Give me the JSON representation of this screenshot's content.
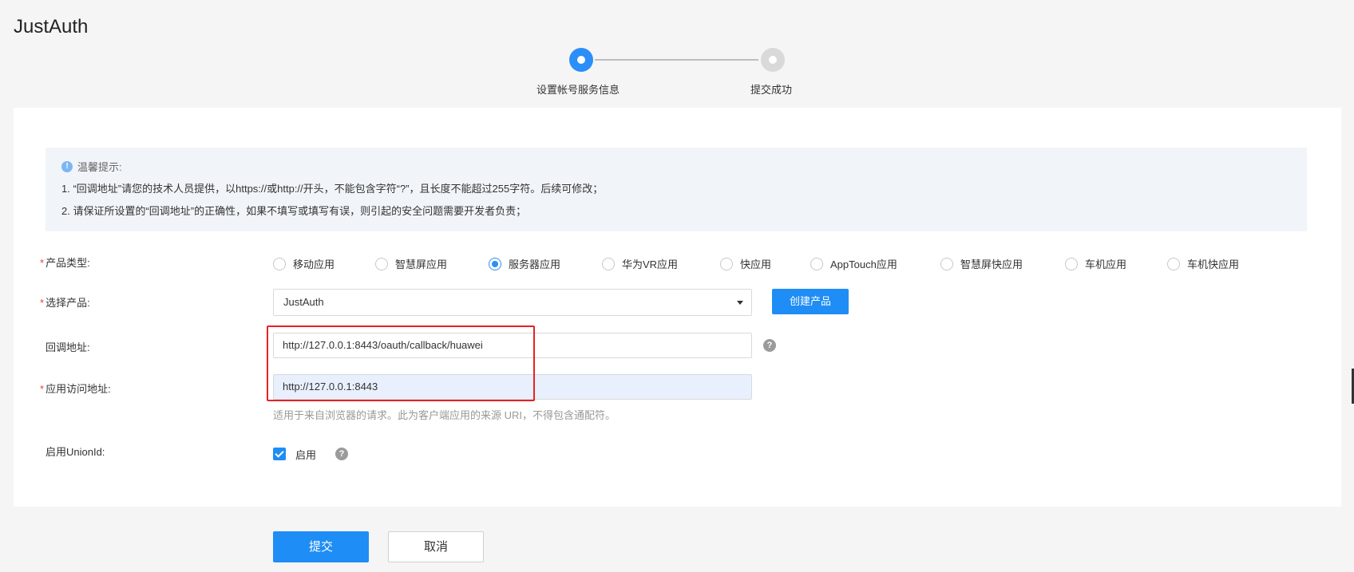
{
  "app": {
    "title": "JustAuth"
  },
  "steps": [
    {
      "label": "设置帐号服务信息",
      "state": "active"
    },
    {
      "label": "提交成功",
      "state": "todo"
    }
  ],
  "notice": {
    "title": "温馨提示:",
    "lines": [
      "1. “回调地址”请您的技术人员提供，以https://或http://开头，不能包含字符“?”，且长度不能超过255字符。后续可修改；",
      "2. 请保证所设置的“回调地址”的正确性，如果不填写或填写有误，则引起的安全问题需要开发者负责；"
    ]
  },
  "form": {
    "required_mark": "*",
    "product_type": {
      "label": "产品类型:",
      "options": [
        "移动应用",
        "智慧屏应用",
        "服务器应用",
        "华为VR应用",
        "快应用",
        "AppTouch应用",
        "智慧屏快应用",
        "车机应用",
        "车机快应用"
      ],
      "selected": "服务器应用"
    },
    "product": {
      "label": "选择产品:",
      "value": "JustAuth",
      "create_label": "创建产品"
    },
    "callback": {
      "label": "回调地址:",
      "value": "http://127.0.0.1:8443/oauth/callback/huawei",
      "help": "?"
    },
    "app_url": {
      "label": "应用访问地址:",
      "value": "http://127.0.0.1:8443",
      "hint": "适用于来自浏览器的请求。此为客户端应用的来源 URI，不得包含通配符。"
    },
    "unionid": {
      "label": "启用UnionId:",
      "checkbox_label": "启用",
      "checked": true,
      "help": "?"
    }
  },
  "actions": {
    "submit": "提交",
    "cancel": "取消"
  },
  "colors": {
    "primary": "#1e8df5",
    "highlight_border": "#e62222",
    "required": "#f04134"
  }
}
